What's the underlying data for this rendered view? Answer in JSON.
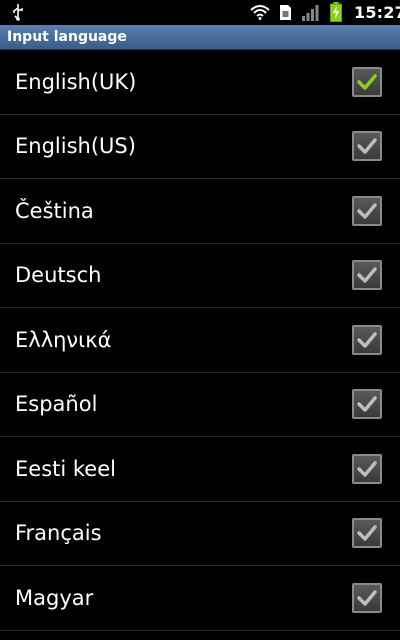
{
  "status_bar": {
    "time": "15:27",
    "icons": [
      "usb-icon",
      "wifi-icon",
      "sim-card-icon",
      "signal-icon",
      "battery-charging-icon"
    ]
  },
  "title": "Input language",
  "languages": [
    {
      "label": "English(UK)",
      "checked": true,
      "check_color": "#8bd11f"
    },
    {
      "label": "English(US)",
      "checked": true,
      "check_color": "#bdbdbd"
    },
    {
      "label": "Čeština",
      "checked": true,
      "check_color": "#bdbdbd"
    },
    {
      "label": "Deutsch",
      "checked": true,
      "check_color": "#bdbdbd"
    },
    {
      "label": "Ελληνικά",
      "checked": true,
      "check_color": "#bdbdbd"
    },
    {
      "label": "Español",
      "checked": true,
      "check_color": "#bdbdbd"
    },
    {
      "label": "Eesti keel",
      "checked": true,
      "check_color": "#bdbdbd"
    },
    {
      "label": "Français",
      "checked": true,
      "check_color": "#bdbdbd"
    },
    {
      "label": "Magyar",
      "checked": true,
      "check_color": "#bdbdbd"
    }
  ],
  "colors": {
    "title_bar": "#4a6e9c",
    "background": "#000000",
    "active_check": "#8bd11f",
    "disabled_check": "#bdbdbd"
  }
}
